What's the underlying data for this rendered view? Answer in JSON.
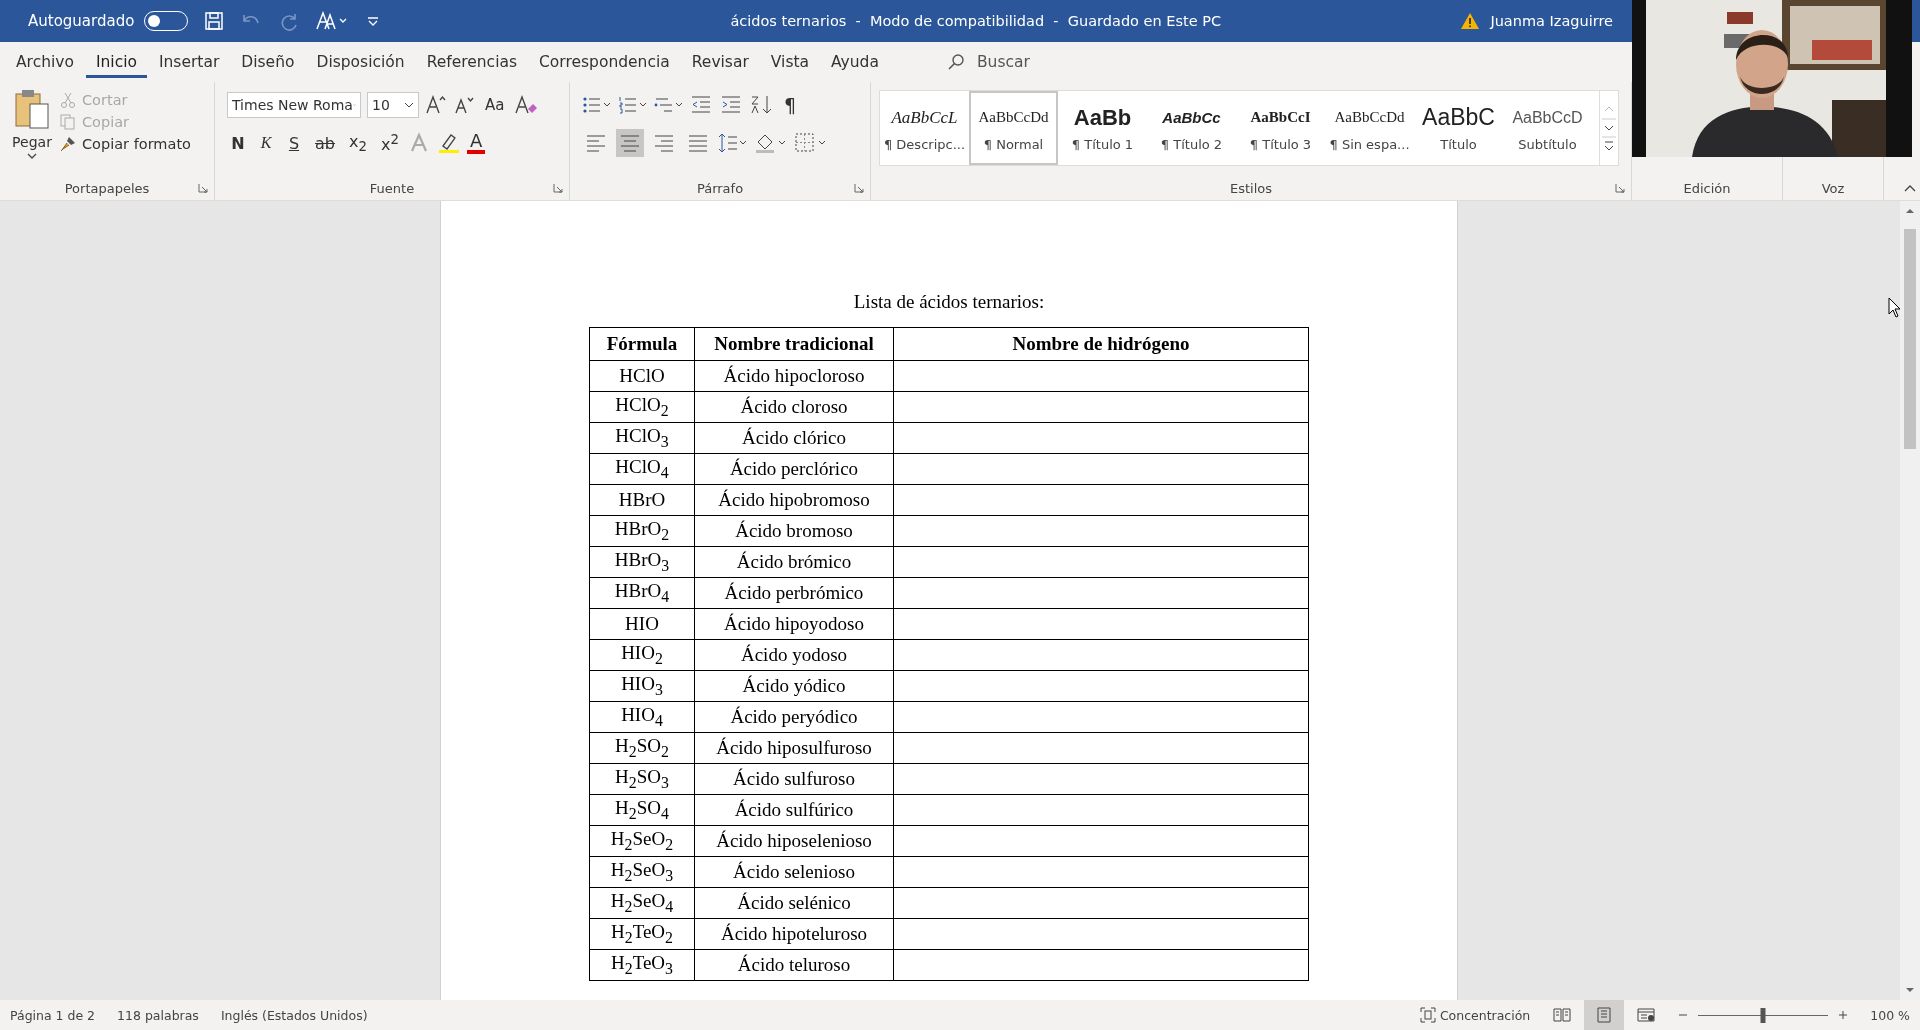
{
  "title_bar": {
    "autosave_label": "Autoguardado",
    "autosave_on": false,
    "title": "ácidos ternarios  -  Modo de compatibilidad  -  Guardado en Este PC",
    "user": "Juanma Izaguirre"
  },
  "menu_tabs": [
    {
      "label": "Archivo",
      "selected": false
    },
    {
      "label": "Inicio",
      "selected": true
    },
    {
      "label": "Insertar",
      "selected": false
    },
    {
      "label": "Diseño",
      "selected": false
    },
    {
      "label": "Disposición",
      "selected": false
    },
    {
      "label": "Referencias",
      "selected": false
    },
    {
      "label": "Correspondencia",
      "selected": false
    },
    {
      "label": "Revisar",
      "selected": false
    },
    {
      "label": "Vista",
      "selected": false
    },
    {
      "label": "Ayuda",
      "selected": false
    }
  ],
  "search": {
    "placeholder": "Buscar"
  },
  "clipboard": {
    "paste": "Pegar",
    "items": [
      {
        "label": "Cortar",
        "disabled": true
      },
      {
        "label": "Copiar",
        "disabled": true
      },
      {
        "label": "Copiar formato",
        "disabled": false
      }
    ],
    "group": "Portapapeles"
  },
  "font": {
    "name": "Times New Roma",
    "size": "10",
    "case_button": "Aa",
    "format_buttons": [
      {
        "label": "N",
        "kind": "bold"
      },
      {
        "label": "K",
        "kind": "italic"
      },
      {
        "label": "S",
        "kind": "underline"
      },
      {
        "label": "ab",
        "kind": "strike"
      },
      {
        "label": "x$_{2}$",
        "kind": "plain"
      },
      {
        "label": "x$^{2}$",
        "kind": "plain"
      }
    ],
    "font_color": {
      "label": "A",
      "color": "#e00000"
    },
    "group": "Fuente"
  },
  "paragraph": {
    "pilcrow": "¶",
    "alignments": [
      {
        "selected": false
      },
      {
        "selected": true
      },
      {
        "selected": false
      },
      {
        "selected": false
      }
    ],
    "group": "Párrafo"
  },
  "styles": {
    "items": [
      {
        "preview": "AaBbCcL",
        "label": "¶ Descripc...",
        "kind": "caption",
        "selected": false
      },
      {
        "preview": "AaBbCcDd",
        "label": "¶ Normal",
        "kind": "normal",
        "selected": true
      },
      {
        "preview": "AaBb",
        "label": "¶ Título 1",
        "kind": "h1",
        "selected": false
      },
      {
        "preview": "AaBbCc",
        "label": "¶ Título 2",
        "kind": "h2",
        "selected": false
      },
      {
        "preview": "AaBbCcI",
        "label": "¶ Título 3",
        "kind": "h3",
        "selected": false
      },
      {
        "preview": "AaBbCcDd",
        "label": "¶ Sin espa...",
        "kind": "normal",
        "selected": false
      },
      {
        "preview": "AaBbC",
        "label": "Título",
        "kind": "title",
        "selected": false
      },
      {
        "preview": "AaBbCcD",
        "label": "Subtítulo",
        "kind": "subtitle",
        "selected": false
      }
    ],
    "group": "Estilos"
  },
  "editing": {
    "group": "Edición"
  },
  "voice": {
    "group": "Voz"
  },
  "document": {
    "heading": "Lista de ácidos ternarios:",
    "columns": [
      "Fórmula",
      "Nombre tradicional",
      "Nombre de hidrógeno"
    ],
    "rows": [
      [
        "HClO",
        "Ácido hipocloroso",
        ""
      ],
      [
        "HClO$_{2}$",
        "Ácido cloroso",
        ""
      ],
      [
        "HClO$_{3}$",
        "Ácido clórico",
        ""
      ],
      [
        "HClO$_{4}$",
        "Ácido perclórico",
        ""
      ],
      [
        "HBrO",
        "Ácido hipobromoso",
        ""
      ],
      [
        "HBrO$_{2}$",
        "Ácido bromoso",
        ""
      ],
      [
        "HBrO$_{3}$",
        "Ácido brómico",
        ""
      ],
      [
        "HBrO$_{4}$",
        "Ácido perbrómico",
        ""
      ],
      [
        "HIO",
        "Ácido hipoyodoso",
        ""
      ],
      [
        "HIO$_{2}$",
        "Ácido yodoso",
        ""
      ],
      [
        "HIO$_{3}$",
        "Ácido yódico",
        ""
      ],
      [
        "HIO$_{4}$",
        "Ácido peryódico",
        ""
      ],
      [
        "H$_{2}$SO$_{2}$",
        "Ácido hiposulfuroso",
        ""
      ],
      [
        "H$_{2}$SO$_{3}$",
        "Ácido sulfuroso",
        ""
      ],
      [
        "H$_{2}$SO$_{4}$",
        "Ácido sulfúrico",
        ""
      ],
      [
        "H$_{2}$SeO$_{2}$",
        "Ácido hiposelenioso",
        ""
      ],
      [
        "H$_{2}$SeO$_{3}$",
        "Ácido selenioso",
        ""
      ],
      [
        "H$_{2}$SeO$_{4}$",
        "Ácido selénico",
        ""
      ],
      [
        "H$_{2}$TeO$_{2}$",
        "Ácido hipoteluroso",
        ""
      ],
      [
        "H$_{2}$TeO$_{3}$",
        "Ácido teluroso",
        ""
      ]
    ]
  },
  "status_bar": {
    "page": "Página 1 de 2",
    "words": "118 palabras",
    "language": "Inglés (Estados Unidos)",
    "focus": "Concentración",
    "views": [
      {
        "selected": false
      },
      {
        "selected": true
      },
      {
        "selected": false
      }
    ],
    "zoom": {
      "level": 0.5,
      "reading": "100 %"
    }
  }
}
